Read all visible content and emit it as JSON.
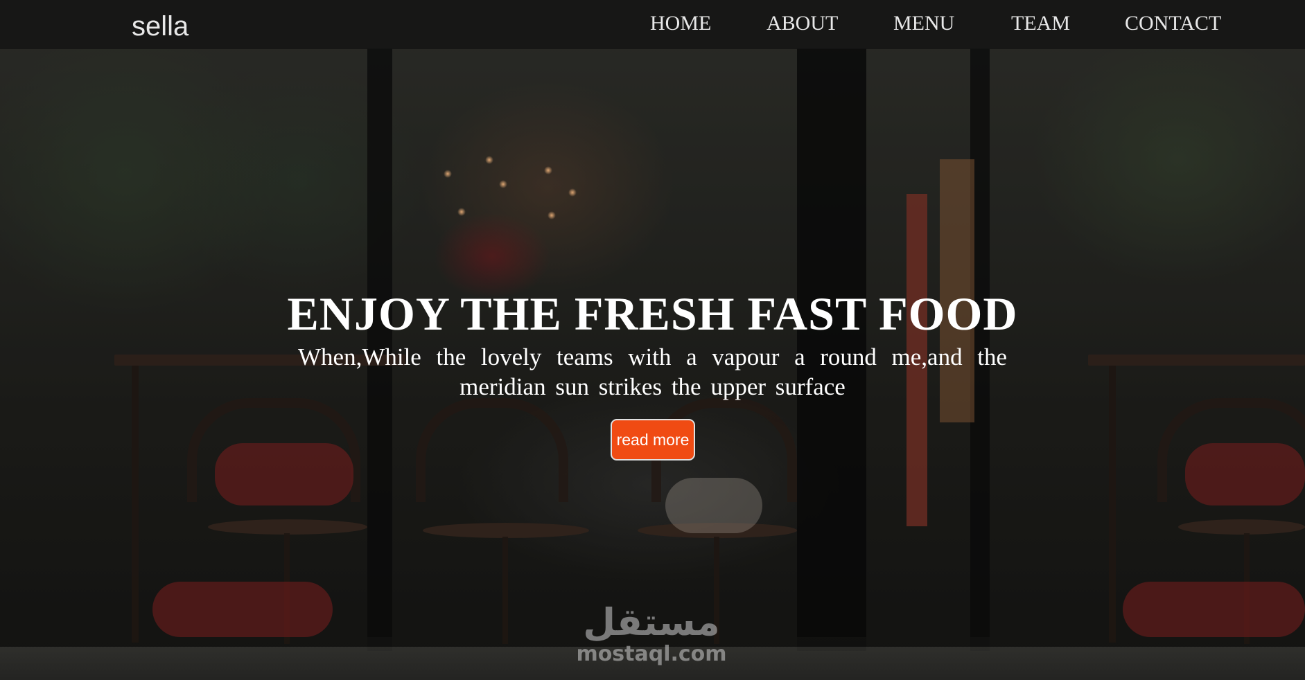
{
  "brand": {
    "logo": "sella"
  },
  "nav": {
    "home": "HOME",
    "about": "ABOUT",
    "menu": "MENU",
    "team": "TEAM",
    "contact": "CONTACT"
  },
  "hero": {
    "headline": "ENJOY THE FRESH FAST FOOD",
    "subtitle": "When,While the lovely teams with a vapour a round me,and the meridian sun strikes the upper surface",
    "cta_label": "read more"
  },
  "watermark": {
    "arabic": "مستقل",
    "latin": "mostaql.com"
  },
  "colors": {
    "accent": "#f04b13",
    "navbar": "#141414",
    "text": "#ffffff"
  }
}
